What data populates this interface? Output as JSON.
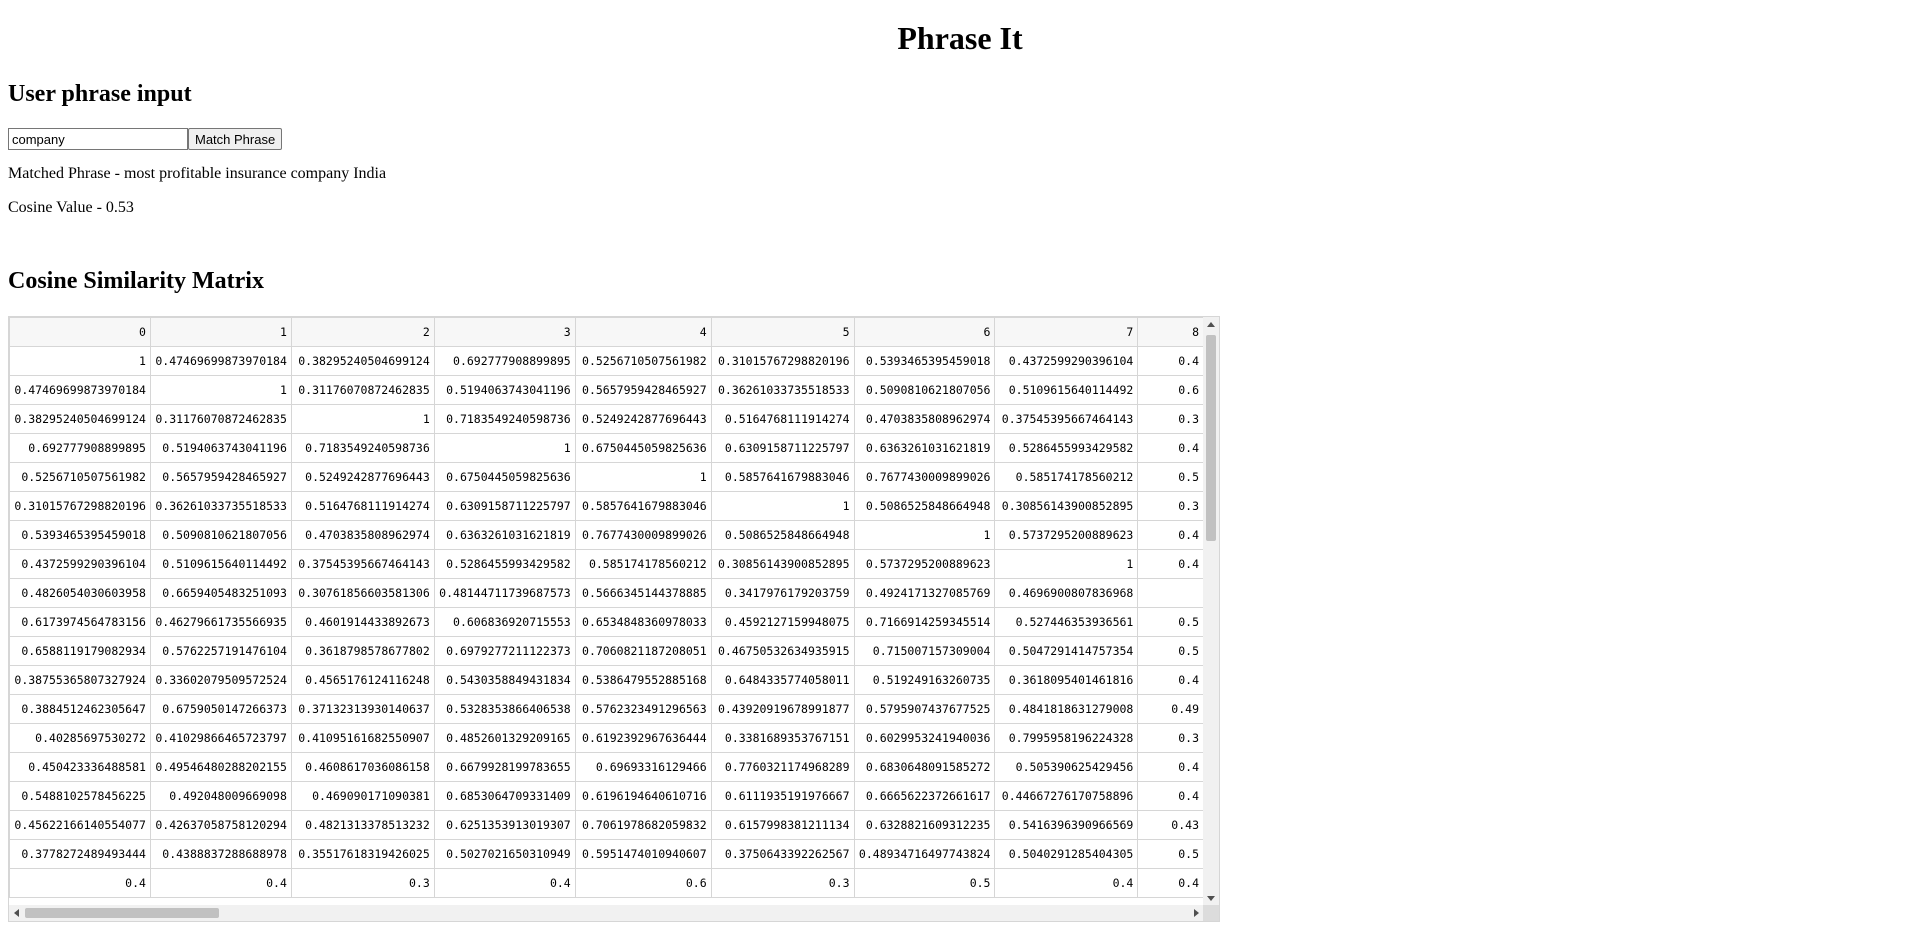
{
  "app": {
    "title": "Phrase It"
  },
  "input_section": {
    "heading": "User phrase input",
    "phrase_value": "company",
    "match_button_label": "Match Phrase"
  },
  "result": {
    "matched_phrase_text": "Matched Phrase - most profitable insurance company India",
    "cosine_value_text": "Cosine Value - 0.53"
  },
  "matrix": {
    "heading": "Cosine Similarity Matrix",
    "column_headers": [
      "0",
      "1",
      "2",
      "3",
      "4",
      "5",
      "6",
      "7",
      "8"
    ],
    "rows": [
      [
        "1",
        "0.47469699873970184",
        "0.38295240504699124",
        "0.692777908899895",
        "0.5256710507561982",
        "0.31015767298820196",
        "0.5393465395459018",
        "0.4372599290396104",
        "0.4"
      ],
      [
        "0.47469699873970184",
        "1",
        "0.31176070872462835",
        "0.5194063743041196",
        "0.5657959428465927",
        "0.36261033735518533",
        "0.5090810621807056",
        "0.5109615640114492",
        "0.6"
      ],
      [
        "0.38295240504699124",
        "0.31176070872462835",
        "1",
        "0.7183549240598736",
        "0.5249242877696443",
        "0.5164768111914274",
        "0.4703835808962974",
        "0.37545395667464143",
        "0.3"
      ],
      [
        "0.692777908899895",
        "0.5194063743041196",
        "0.7183549240598736",
        "1",
        "0.6750445059825636",
        "0.6309158711225797",
        "0.6363261031621819",
        "0.5286455993429582",
        "0.4"
      ],
      [
        "0.5256710507561982",
        "0.5657959428465927",
        "0.5249242877696443",
        "0.6750445059825636",
        "1",
        "0.5857641679883046",
        "0.7677430009899026",
        "0.585174178560212",
        "0.5"
      ],
      [
        "0.31015767298820196",
        "0.36261033735518533",
        "0.5164768111914274",
        "0.6309158711225797",
        "0.5857641679883046",
        "1",
        "0.5086525848664948",
        "0.30856143900852895",
        "0.3"
      ],
      [
        "0.5393465395459018",
        "0.5090810621807056",
        "0.4703835808962974",
        "0.6363261031621819",
        "0.7677430009899026",
        "0.5086525848664948",
        "1",
        "0.5737295200889623",
        "0.4"
      ],
      [
        "0.4372599290396104",
        "0.5109615640114492",
        "0.37545395667464143",
        "0.5286455993429582",
        "0.585174178560212",
        "0.30856143900852895",
        "0.5737295200889623",
        "1",
        "0.4"
      ],
      [
        "0.4826054030603958",
        "0.6659405483251093",
        "0.30761856603581306",
        "0.48144711739687573",
        "0.5666345144378885",
        "0.3417976179203759",
        "0.4924171327085769",
        "0.4696900807836968",
        ""
      ],
      [
        "0.6173974564783156",
        "0.46279661735566935",
        "0.4601914433892673",
        "0.606836920715553",
        "0.6534848360978033",
        "0.4592127159948075",
        "0.7166914259345514",
        "0.527446353936561",
        "0.5"
      ],
      [
        "0.6588119179082934",
        "0.5762257191476104",
        "0.3618798578677802",
        "0.6979277211122373",
        "0.7060821187208051",
        "0.46750532634935915",
        "0.715007157309004",
        "0.5047291414757354",
        "0.5"
      ],
      [
        "0.38755365807327924",
        "0.33602079509572524",
        "0.4565176124116248",
        "0.5430358849431834",
        "0.5386479552885168",
        "0.6484335774058011",
        "0.519249163260735",
        "0.3618095401461816",
        "0.4"
      ],
      [
        "0.3884512462305647",
        "0.6759050147266373",
        "0.37132313930140637",
        "0.5328353866406538",
        "0.5762323491296563",
        "0.43920919678991877",
        "0.5795907437677525",
        "0.4841818631279008",
        "0.49"
      ],
      [
        "0.40285697530272",
        "0.41029866465723797",
        "0.41095161682550907",
        "0.4852601329209165",
        "0.6192392967636444",
        "0.3381689353767151",
        "0.6029953241940036",
        "0.7995958196224328",
        "0.3"
      ],
      [
        "0.450423336488581",
        "0.49546480288202155",
        "0.4608617036086158",
        "0.6679928199783655",
        "0.69693316129466",
        "0.7760321174968289",
        "0.6830648091585272",
        "0.505390625429456",
        "0.4"
      ],
      [
        "0.5488102578456225",
        "0.492048009669098",
        "0.469090171090381",
        "0.6853064709331409",
        "0.6196194640610716",
        "0.6111935191976667",
        "0.6665622372661617",
        "0.44667276170758896",
        "0.4"
      ],
      [
        "0.45622166140554077",
        "0.42637058758120294",
        "0.4821313378513232",
        "0.6251353913019307",
        "0.7061978682059832",
        "0.6157998381211134",
        "0.6328821609312235",
        "0.5416396390966569",
        "0.43"
      ],
      [
        "0.3778272489493444",
        "0.4388837288688978",
        "0.35517618319426025",
        "0.5027021650310949",
        "0.5951474010940607",
        "0.3750643392262567",
        "0.48934716497743824",
        "0.5040291285404305",
        "0.5"
      ],
      [
        "0.4",
        "0.4",
        "0.3",
        "0.4",
        "0.6",
        "0.3",
        "0.5",
        "0.4",
        "0.4"
      ]
    ]
  }
}
